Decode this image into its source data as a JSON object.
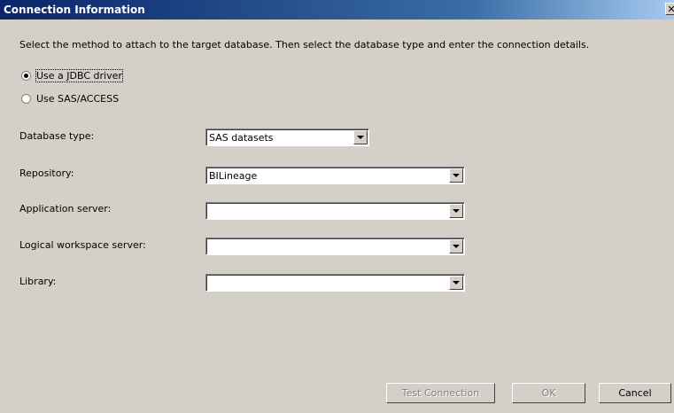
{
  "window": {
    "title": "Connection Information",
    "close_glyph": "✕"
  },
  "instructions": "Select the method to attach to the target database. Then select the database type and enter the connection details.",
  "method": {
    "options": [
      {
        "label": "Use a JDBC driver",
        "checked": true
      },
      {
        "label": "Use SAS/ACCESS",
        "checked": false
      }
    ]
  },
  "fields": {
    "database_type": {
      "label": "Database type:",
      "value": "SAS datasets"
    },
    "repository": {
      "label": "Repository:",
      "value": "BILineage"
    },
    "application_server": {
      "label": "Application server:",
      "value": ""
    },
    "logical_workspace_server": {
      "label": "Logical workspace server:",
      "value": ""
    },
    "library": {
      "label": "Library:",
      "value": ""
    }
  },
  "buttons": {
    "test_connection": "Test Connection",
    "ok": "OK",
    "cancel": "Cancel"
  },
  "icons": [
    "dropdown-arrow-icon",
    "close-icon"
  ]
}
